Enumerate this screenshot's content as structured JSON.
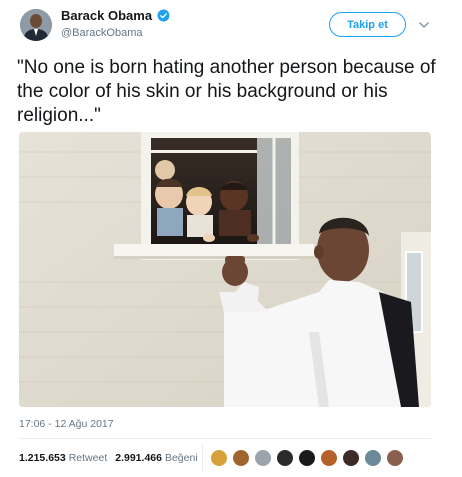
{
  "header": {
    "name": "Barack Obama",
    "handle": "@BarackObama",
    "follow_label": "Takip et"
  },
  "tweet": {
    "text": "\"No one is born hating another person because of the color of his skin or his background or his religion...\"",
    "timestamp": "17:06 - 12 Ağu 2017"
  },
  "stats": {
    "retweets_count": "1.215.653",
    "retweets_label": "Retweet",
    "likes_count": "2.991.466",
    "likes_label": "Beğeni"
  },
  "colors": {
    "accent": "#1da1f2",
    "secondary_text": "#657786",
    "divider": "#e6ecf0"
  },
  "likers": [
    "#d8a23a",
    "#a0652f",
    "#9aa4ad",
    "#2a2a2a",
    "#1a1a1a",
    "#b5612a",
    "#3e2a26",
    "#6c8a98",
    "#8a5f4f"
  ]
}
